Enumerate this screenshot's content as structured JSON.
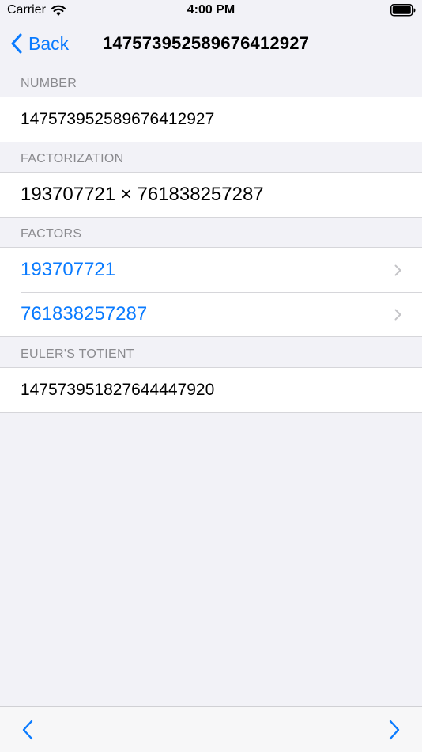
{
  "status_bar": {
    "carrier": "Carrier",
    "time": "4:00 PM"
  },
  "nav": {
    "back_label": "Back",
    "title": "147573952589676412927"
  },
  "sections": {
    "number": {
      "header": "NUMBER",
      "value": "147573952589676412927"
    },
    "factorization": {
      "header": "FACTORIZATION",
      "value": "193707721 × 761838257287"
    },
    "factors": {
      "header": "FACTORS",
      "items": [
        "193707721",
        "761838257287"
      ]
    },
    "totient": {
      "header": "EULER'S TOTIENT",
      "value": "147573951827644447920"
    }
  },
  "toolbar": {
    "prev_icon": "chevron-left-icon",
    "next_icon": "chevron-right-icon"
  },
  "colors": {
    "accent": "#0a7bff",
    "background": "#f2f2f7",
    "secondary_text": "#8a8a8e"
  }
}
